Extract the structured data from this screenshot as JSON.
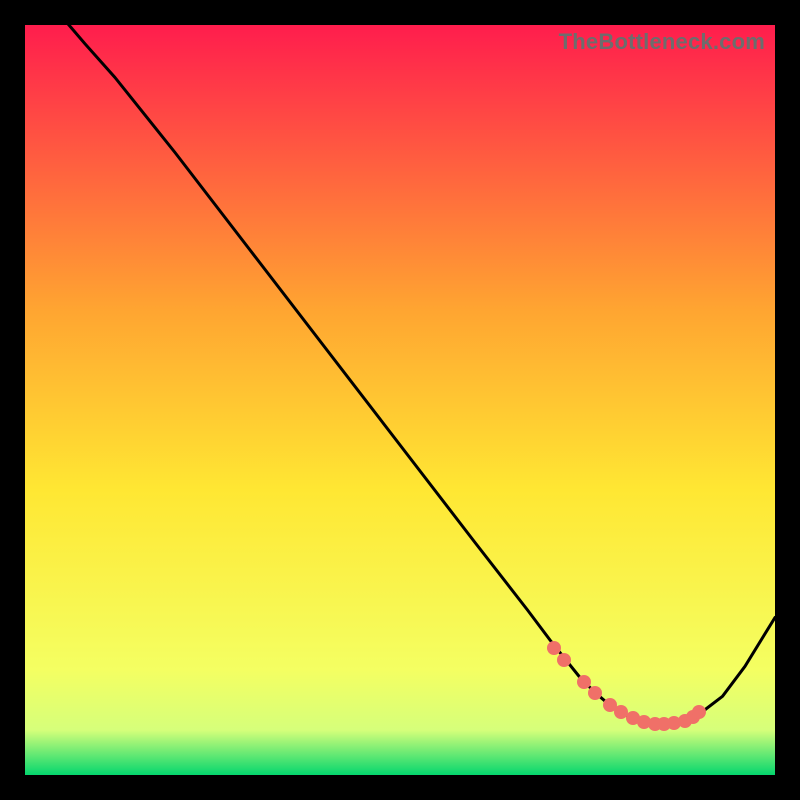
{
  "watermark": "TheBottleneck.com",
  "chart_data": {
    "type": "line",
    "title": "",
    "xlabel": "",
    "ylabel": "",
    "xlim": [
      0,
      100
    ],
    "ylim": [
      0,
      100
    ],
    "background_gradient": {
      "top": "#ff1d4d",
      "mid_upper": "#ffa531",
      "mid": "#ffe733",
      "mid_lower": "#f4ff62",
      "bottom": "#05d66e"
    },
    "series": [
      {
        "name": "bottleneck-curve",
        "color": "#000000",
        "x": [
          0,
          5,
          8,
          12,
          20,
          30,
          40,
          50,
          60,
          67,
          70,
          72,
          74,
          76,
          78,
          80,
          82,
          84,
          86,
          88,
          90,
          93,
          96,
          100
        ],
        "y": [
          108,
          101,
          97.5,
          93,
          83,
          70,
          57,
          44,
          31,
          22,
          18,
          15.5,
          13,
          11,
          9.3,
          8,
          7.2,
          6.8,
          6.8,
          7.2,
          8.2,
          10.5,
          14.5,
          21
        ]
      }
    ],
    "markers": {
      "name": "highlight-dots",
      "color": "#f07068",
      "x": [
        70.5,
        71.8,
        74.5,
        76.0,
        78.0,
        79.5,
        81.0,
        82.5,
        84.0,
        85.2,
        86.5,
        88.0,
        89.0,
        89.8
      ],
      "y": [
        17,
        15.3,
        12.4,
        11.0,
        9.4,
        8.4,
        7.6,
        7.1,
        6.8,
        6.8,
        6.9,
        7.2,
        7.8,
        8.4
      ]
    }
  }
}
